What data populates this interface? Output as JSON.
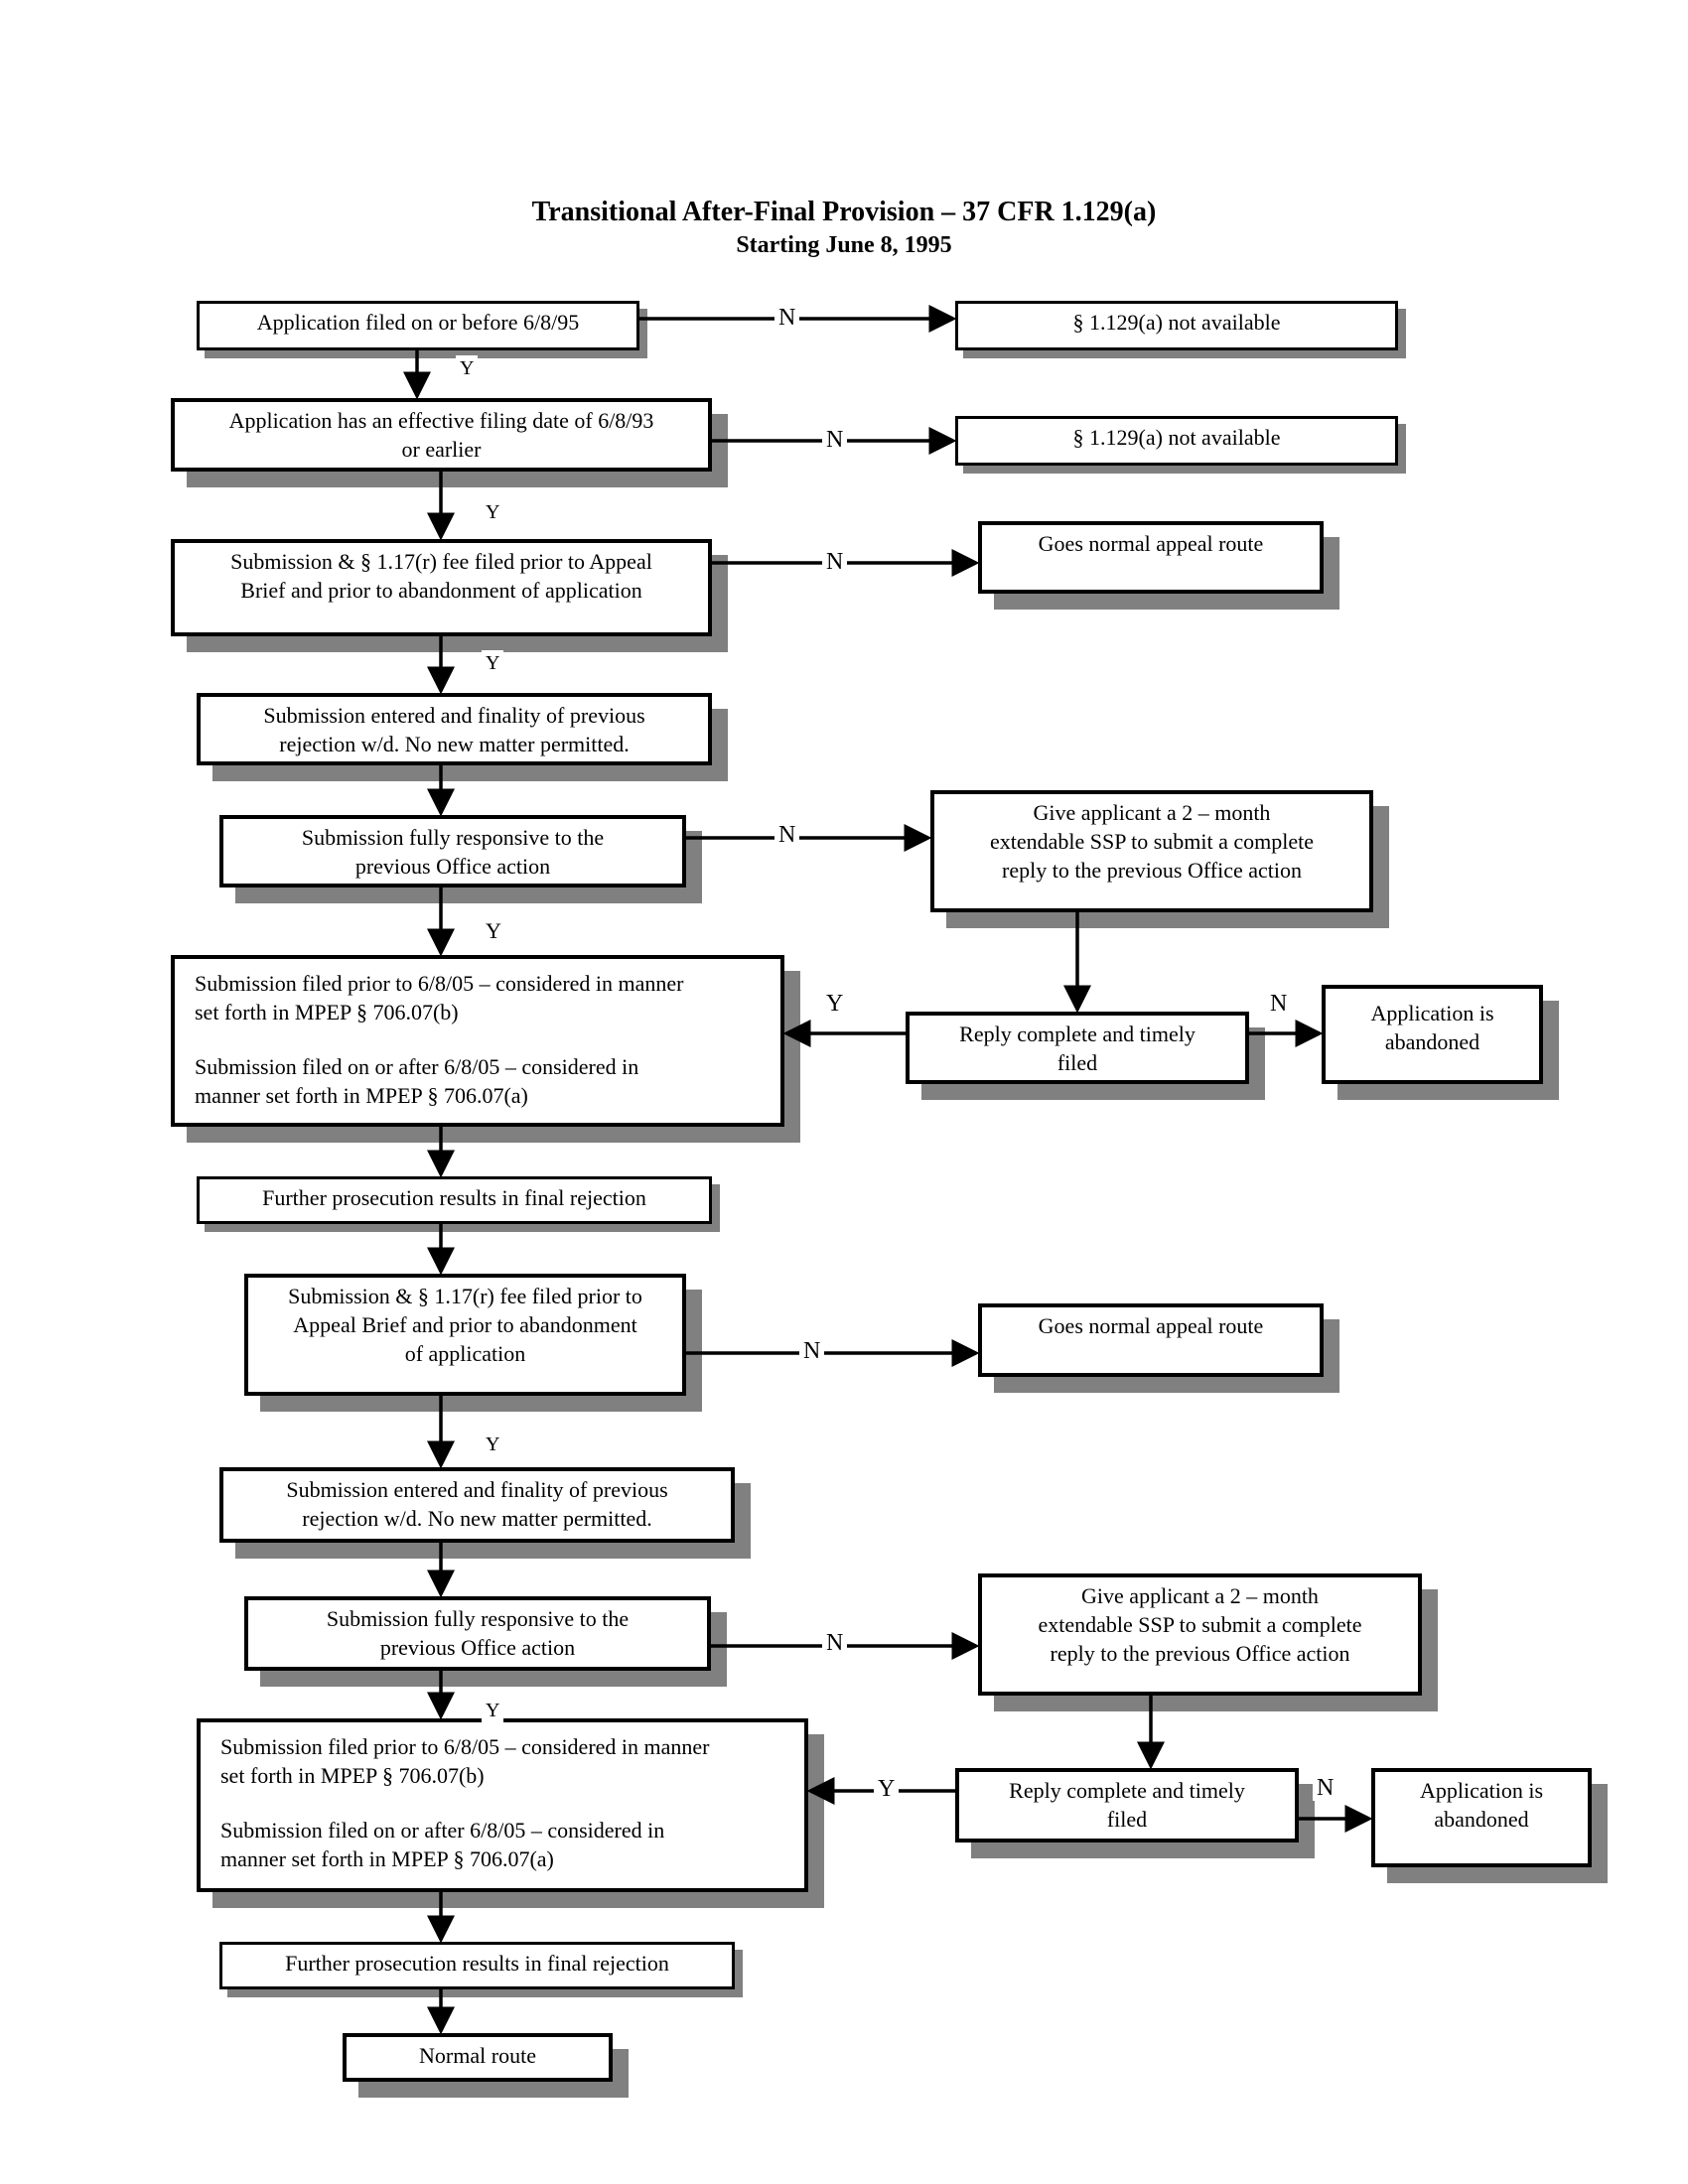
{
  "title": "Transitional After-Final Provision – 37 CFR 1.129(a)",
  "subtitle": "Starting June 8, 1995",
  "nodes": {
    "b1": "Application filed on or before 6/8/95",
    "na1": "§ 1.129(a) not available",
    "b2_l1": "Application has an effective filing date of 6/8/93",
    "b2_l2": "or earlier",
    "na2": "§ 1.129(a) not available",
    "b3_l1": "Submission & § 1.17(r) fee filed prior to Appeal",
    "b3_l2": "Brief and prior to abandonment of application",
    "gn1": "Goes normal appeal route",
    "b4_l1": "Submission entered and finality of previous",
    "b4_l2": "rejection w/d.  No new matter permitted.",
    "b5_l1": "Submission fully responsive to the",
    "b5_l2": "previous Office action",
    "ssp1_l1": "Give applicant a 2 – month",
    "ssp1_l2": "extendable SSP to submit a complete",
    "ssp1_l3": "reply to the previous Office action",
    "b6_p1_l1": "Submission filed prior to 6/8/05 – considered in manner",
    "b6_p1_l2": "set forth in MPEP § 706.07(b)",
    "b6_p2_l1": "Submission filed on or after 6/8/05 – considered in",
    "b6_p2_l2": "manner set forth in MPEP § 706.07(a)",
    "r1_l1": "Reply complete and timely",
    "r1_l2": "filed",
    "ab1_l1": "Application is",
    "ab1_l2": "abandoned",
    "b7": "Further prosecution results in final rejection",
    "b8_l1": "Submission & § 1.17(r) fee filed prior to",
    "b8_l2": "Appeal Brief and prior to abandonment",
    "b8_l3": "of application",
    "gn2": "Goes normal appeal route",
    "b9_l1": "Submission entered and finality of previous",
    "b9_l2": "rejection w/d.  No new matter permitted.",
    "b10_l1": "Submission fully responsive to the",
    "b10_l2": "previous Office action",
    "ssp2_l1": "Give applicant a 2 – month",
    "ssp2_l2": "extendable SSP to submit a complete",
    "ssp2_l3": "reply to the previous Office action",
    "b11_p1_l1": "Submission filed prior to 6/8/05 – considered in manner",
    "b11_p1_l2": "set forth in MPEP § 706.07(b)",
    "b11_p2_l1": "Submission filed on or after 6/8/05 – considered in",
    "b11_p2_l2": "manner set forth in MPEP § 706.07(a)",
    "r2_l1": "Reply complete and timely",
    "r2_l2": "filed",
    "ab2_l1": "Application is",
    "ab2_l2": "abandoned",
    "b12": "Further prosecution results in final rejection",
    "b13": "Normal route"
  },
  "edge_labels": {
    "yes": "Y",
    "no": "N"
  }
}
